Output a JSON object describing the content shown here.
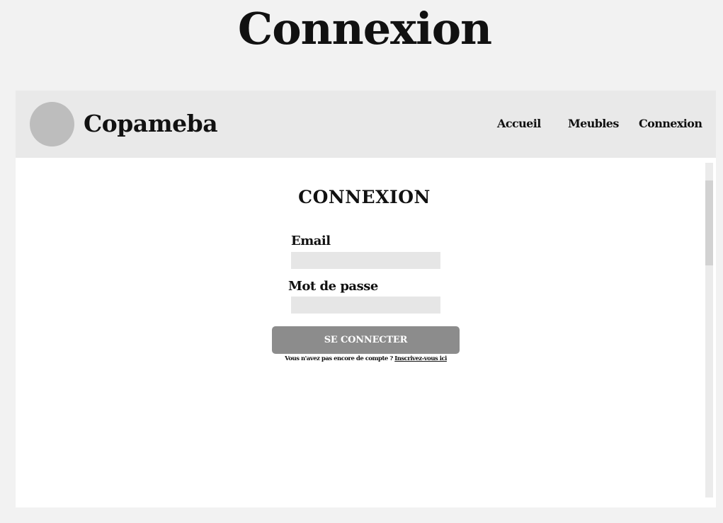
{
  "page": {
    "title": "Connexion"
  },
  "navbar": {
    "brand": "Copameba",
    "links": [
      {
        "label": "Accueil"
      },
      {
        "label": "Meubles"
      },
      {
        "label": "Connexion"
      }
    ]
  },
  "form": {
    "title": "CONNEXION",
    "email_label": "Email",
    "email_value": "",
    "password_label": "Mot de passe",
    "password_value": "",
    "submit_label": "SE CONNECTER",
    "signup_prompt": "Vous n'avez pas encore de compte ? ",
    "signup_link": "Inscrivez-vous ici"
  },
  "colors": {
    "page_background": "#f2f2f2",
    "navbar_background": "#e9e9e9",
    "logo_circle": "#bdbdbd",
    "input_background": "#e6e6e6",
    "button_background": "#8c8c8c",
    "text": "#111111"
  },
  "icons": {
    "logo": "logo-circle-icon"
  }
}
